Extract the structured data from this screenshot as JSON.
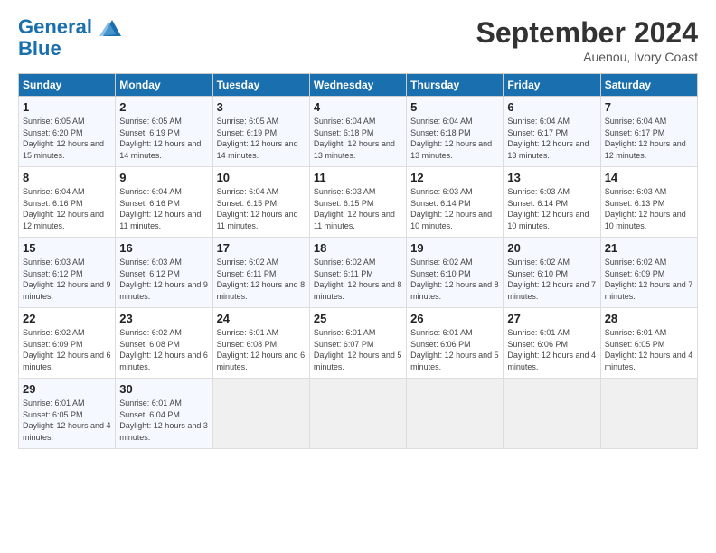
{
  "logo": {
    "line1": "General",
    "line2": "Blue"
  },
  "title": "September 2024",
  "location": "Auenou, Ivory Coast",
  "days_of_week": [
    "Sunday",
    "Monday",
    "Tuesday",
    "Wednesday",
    "Thursday",
    "Friday",
    "Saturday"
  ],
  "weeks": [
    [
      {
        "day": "1",
        "sunrise": "6:05 AM",
        "sunset": "6:20 PM",
        "daylight": "12 hours and 15 minutes."
      },
      {
        "day": "2",
        "sunrise": "6:05 AM",
        "sunset": "6:19 PM",
        "daylight": "12 hours and 14 minutes."
      },
      {
        "day": "3",
        "sunrise": "6:05 AM",
        "sunset": "6:19 PM",
        "daylight": "12 hours and 14 minutes."
      },
      {
        "day": "4",
        "sunrise": "6:04 AM",
        "sunset": "6:18 PM",
        "daylight": "12 hours and 13 minutes."
      },
      {
        "day": "5",
        "sunrise": "6:04 AM",
        "sunset": "6:18 PM",
        "daylight": "12 hours and 13 minutes."
      },
      {
        "day": "6",
        "sunrise": "6:04 AM",
        "sunset": "6:17 PM",
        "daylight": "12 hours and 13 minutes."
      },
      {
        "day": "7",
        "sunrise": "6:04 AM",
        "sunset": "6:17 PM",
        "daylight": "12 hours and 12 minutes."
      }
    ],
    [
      {
        "day": "8",
        "sunrise": "6:04 AM",
        "sunset": "6:16 PM",
        "daylight": "12 hours and 12 minutes."
      },
      {
        "day": "9",
        "sunrise": "6:04 AM",
        "sunset": "6:16 PM",
        "daylight": "12 hours and 11 minutes."
      },
      {
        "day": "10",
        "sunrise": "6:04 AM",
        "sunset": "6:15 PM",
        "daylight": "12 hours and 11 minutes."
      },
      {
        "day": "11",
        "sunrise": "6:03 AM",
        "sunset": "6:15 PM",
        "daylight": "12 hours and 11 minutes."
      },
      {
        "day": "12",
        "sunrise": "6:03 AM",
        "sunset": "6:14 PM",
        "daylight": "12 hours and 10 minutes."
      },
      {
        "day": "13",
        "sunrise": "6:03 AM",
        "sunset": "6:14 PM",
        "daylight": "12 hours and 10 minutes."
      },
      {
        "day": "14",
        "sunrise": "6:03 AM",
        "sunset": "6:13 PM",
        "daylight": "12 hours and 10 minutes."
      }
    ],
    [
      {
        "day": "15",
        "sunrise": "6:03 AM",
        "sunset": "6:12 PM",
        "daylight": "12 hours and 9 minutes."
      },
      {
        "day": "16",
        "sunrise": "6:03 AM",
        "sunset": "6:12 PM",
        "daylight": "12 hours and 9 minutes."
      },
      {
        "day": "17",
        "sunrise": "6:02 AM",
        "sunset": "6:11 PM",
        "daylight": "12 hours and 8 minutes."
      },
      {
        "day": "18",
        "sunrise": "6:02 AM",
        "sunset": "6:11 PM",
        "daylight": "12 hours and 8 minutes."
      },
      {
        "day": "19",
        "sunrise": "6:02 AM",
        "sunset": "6:10 PM",
        "daylight": "12 hours and 8 minutes."
      },
      {
        "day": "20",
        "sunrise": "6:02 AM",
        "sunset": "6:10 PM",
        "daylight": "12 hours and 7 minutes."
      },
      {
        "day": "21",
        "sunrise": "6:02 AM",
        "sunset": "6:09 PM",
        "daylight": "12 hours and 7 minutes."
      }
    ],
    [
      {
        "day": "22",
        "sunrise": "6:02 AM",
        "sunset": "6:09 PM",
        "daylight": "12 hours and 6 minutes."
      },
      {
        "day": "23",
        "sunrise": "6:02 AM",
        "sunset": "6:08 PM",
        "daylight": "12 hours and 6 minutes."
      },
      {
        "day": "24",
        "sunrise": "6:01 AM",
        "sunset": "6:08 PM",
        "daylight": "12 hours and 6 minutes."
      },
      {
        "day": "25",
        "sunrise": "6:01 AM",
        "sunset": "6:07 PM",
        "daylight": "12 hours and 5 minutes."
      },
      {
        "day": "26",
        "sunrise": "6:01 AM",
        "sunset": "6:06 PM",
        "daylight": "12 hours and 5 minutes."
      },
      {
        "day": "27",
        "sunrise": "6:01 AM",
        "sunset": "6:06 PM",
        "daylight": "12 hours and 4 minutes."
      },
      {
        "day": "28",
        "sunrise": "6:01 AM",
        "sunset": "6:05 PM",
        "daylight": "12 hours and 4 minutes."
      }
    ],
    [
      {
        "day": "29",
        "sunrise": "6:01 AM",
        "sunset": "6:05 PM",
        "daylight": "12 hours and 4 minutes."
      },
      {
        "day": "30",
        "sunrise": "6:01 AM",
        "sunset": "6:04 PM",
        "daylight": "12 hours and 3 minutes."
      },
      null,
      null,
      null,
      null,
      null
    ]
  ]
}
